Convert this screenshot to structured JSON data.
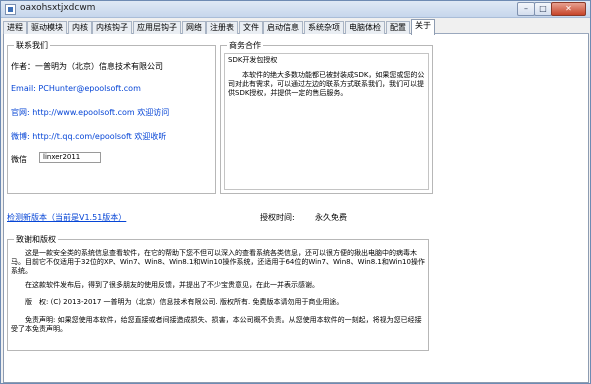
{
  "window": {
    "title": "oaxohsxtjxdcwm",
    "min": "–",
    "max": "□",
    "close": "✕"
  },
  "tabs": [
    "进程",
    "驱动模块",
    "内核",
    "内核钩子",
    "应用层钩子",
    "网络",
    "注册表",
    "文件",
    "启动信息",
    "系统杂项",
    "电脑体检",
    "配置",
    "关于"
  ],
  "active_tab": "关于",
  "contact": {
    "title": "联系我们",
    "author": "作者：一普明为（北京）信息技术有限公司",
    "email": "Email: PCHunter@epoolsoft.com",
    "website": "官网: http://www.epoolsoft.com 欢迎访问",
    "weibo": "微博: http://t.qq.com/epoolsoft 欢迎收听",
    "wechat_label": "微信",
    "wechat_value": "linxer2011"
  },
  "business": {
    "title": "商务合作",
    "heading": "SDK开发包授权",
    "body": "　　本软件的绝大多数功能都已被封装成SDK，如果您或您的公司对此有需求，可以通过左边的联系方式联系我们，我们可以提供SDK授权，并提供一定的售后服务。"
  },
  "update_link": "检测新版本（当前是V1.51版本）",
  "license_label": "授权时间:",
  "license_value": "永久免费",
  "thanks": {
    "title": "致谢和版权",
    "p1": "　　这是一款安全类的系统信息查看软件，在它的帮助下您不但可以深入的查看系统各类信息，还可以很方便的揪出电脑中的病毒木马。目前它不仅适用于32位的XP、Win7、Win8、Win8.1和Win10操作系统，还适用于64位的Win7、Win8、Win8.1和Win10操作系统。",
    "p2": "　　在这款软件发布后，得到了很多朋友的使用反馈，并提出了不少宝贵意见，在此一并表示感谢。",
    "p3": "　　版　权: (C) 2013-2017 一普明为（北京）信息技术有限公司. 版权所有. 免费版本请勿用于商业用途。",
    "p4": "　　免责声明: 如果您使用本软件，给您直接或者间接造成损失、损害，本公司概不负责。从您使用本软件的一刻起，将视为您已经接受了本免责声明。"
  }
}
